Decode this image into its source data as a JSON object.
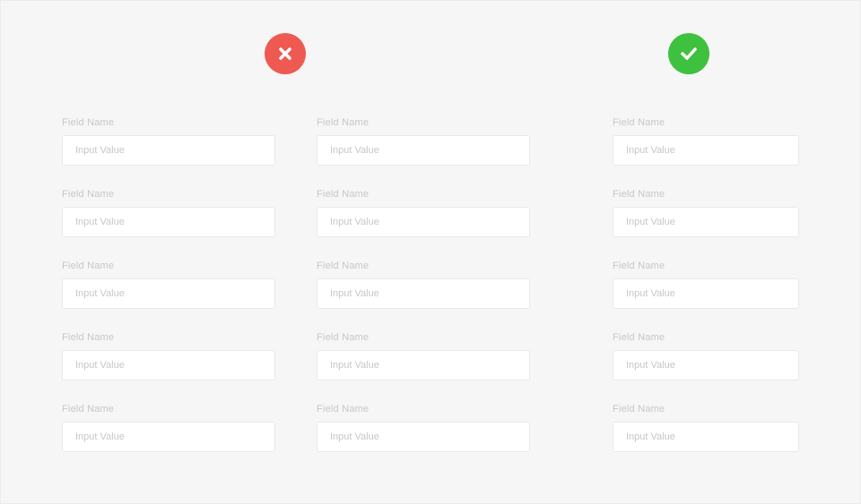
{
  "field_label": "Field Name",
  "field_placeholder": "Input Value",
  "colors": {
    "bad_badge": "#ee5a52",
    "good_badge": "#3ec13e"
  },
  "columns": {
    "left": {
      "badge": "cross",
      "cols": [
        {
          "fields": 5
        },
        {
          "fields": 5
        }
      ]
    },
    "right": {
      "badge": "check",
      "cols": [
        {
          "fields": 5
        }
      ]
    }
  }
}
